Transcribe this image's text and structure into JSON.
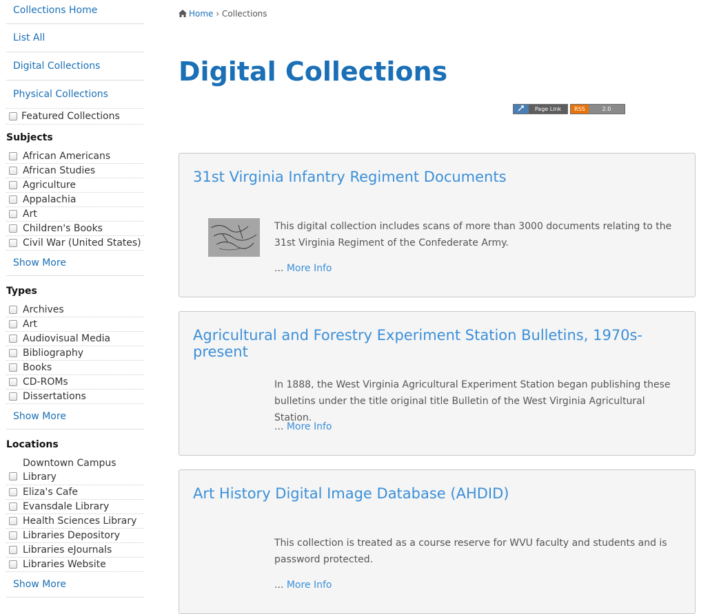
{
  "sidebar": {
    "nav": [
      "Collections Home",
      "List All",
      "Digital Collections",
      "Physical Collections"
    ],
    "featured": "Featured Collections",
    "subjects": {
      "heading": "Subjects",
      "items": [
        "African Americans",
        "African Studies",
        "Agriculture",
        "Appalachia",
        "Art",
        "Children's Books",
        "Civil War (United States)"
      ],
      "show_more": "Show More"
    },
    "types": {
      "heading": "Types",
      "items": [
        "Archives",
        "Art",
        "Audiovisual Media",
        "Bibliography",
        "Books",
        "CD-ROMs",
        "Dissertations"
      ],
      "show_more": "Show More"
    },
    "locations": {
      "heading": "Locations",
      "items": [
        "Downtown Campus Library",
        "Eliza's Cafe",
        "Evansdale Library",
        "Health Sciences Library",
        "Libraries Depository",
        "Libraries eJournals",
        "Libraries Website"
      ],
      "show_more": "Show More"
    }
  },
  "breadcrumb": {
    "home": "Home",
    "separator": "›",
    "current": "Collections",
    "icon": "home-icon"
  },
  "page_title": "Digital Collections",
  "badges": {
    "page_link": {
      "left": "",
      "right": "Page Link"
    },
    "rss": {
      "left": "RSS",
      "right": "2.0"
    }
  },
  "collections": [
    {
      "title": "31st Virginia Infantry Regiment Documents",
      "description": "This digital collection includes scans of more than 3000 documents relating to the 31st Virginia Regiment of the Confederate Army.",
      "more_prefix": "...",
      "more_label": "More Info"
    },
    {
      "title": "Agricultural and Forestry Experiment Station Bulletins, 1970s-present",
      "description": "In 1888, the West Virginia Agricultural Experiment Station began publishing these bulletins under the title original title Bulletin of the West Virginia Agricultural Station.",
      "more_prefix": "...",
      "more_label": "More Info"
    },
    {
      "title": "Art History Digital Image Database (AHDID)",
      "description": "This collection is treated as a course reserve for WVU faculty and students and is password protected.",
      "more_prefix": "...",
      "more_label": "More Info"
    }
  ],
  "colors": {
    "link": "#1a6fb6",
    "card_title": "#3b8fd8",
    "card_bg": "#f5f5f5"
  }
}
